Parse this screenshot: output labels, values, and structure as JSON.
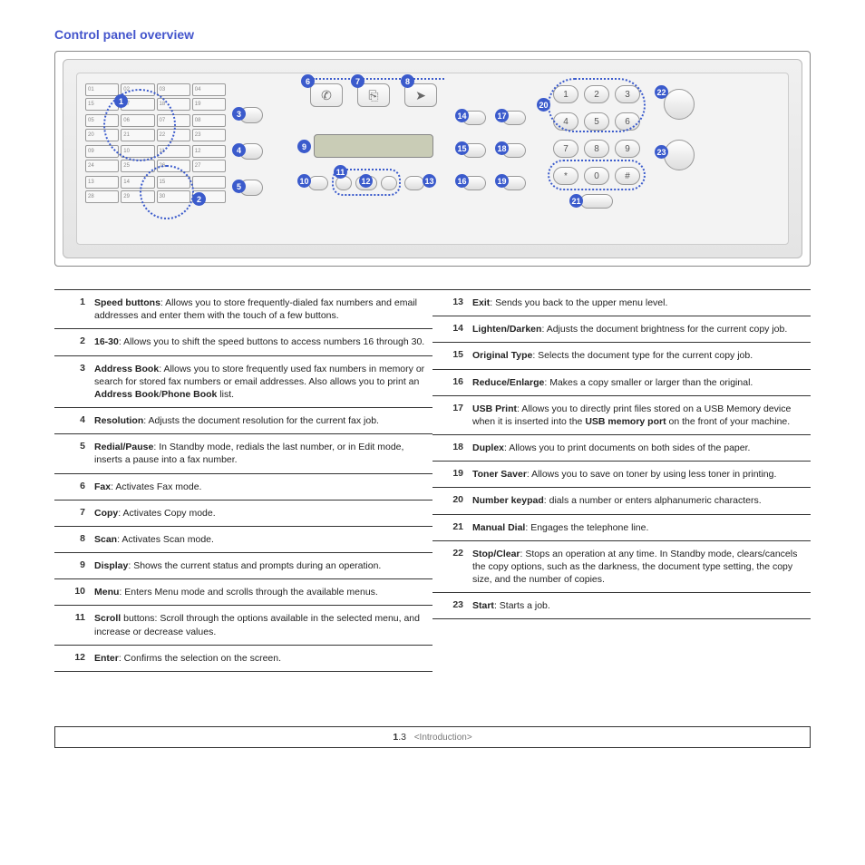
{
  "section_title": "Control panel overview",
  "speed_rows": [
    [
      "01",
      "02",
      "03",
      "04"
    ],
    [
      "15",
      "17",
      "18",
      "19"
    ],
    [
      "05",
      "06",
      "07",
      "08"
    ],
    [
      "20",
      "21",
      "22",
      "23"
    ],
    [
      "09",
      "10",
      "11",
      "12"
    ],
    [
      "24",
      "25",
      "26",
      "27"
    ],
    [
      "13",
      "14",
      "15",
      ""
    ],
    [
      "28",
      "29",
      "30",
      ""
    ]
  ],
  "keypad": [
    "1",
    "2",
    "3",
    "4",
    "5",
    "6",
    "7",
    "8",
    "9",
    "*",
    "0",
    "#"
  ],
  "callouts": {
    "c1": "1",
    "c2": "2",
    "c3": "3",
    "c4": "4",
    "c5": "5",
    "c6": "6",
    "c7": "7",
    "c8": "8",
    "c9": "9",
    "c10": "10",
    "c11": "11",
    "c12": "12",
    "c13": "13",
    "c14": "14",
    "c15": "15",
    "c16": "16",
    "c17": "17",
    "c18": "18",
    "c19": "19",
    "c20": "20",
    "c21": "21",
    "c22": "22",
    "c23": "23"
  },
  "definitions_left": [
    {
      "n": "1",
      "html": "<b>Speed buttons</b>: Allows you to store frequently-dialed fax numbers and email addresses and enter them with the touch of a few buttons."
    },
    {
      "n": "2",
      "html": "<b>16-30</b>: Allows you to shift the speed buttons to access numbers 16 through 30."
    },
    {
      "n": "3",
      "html": "<b>Address Book</b>: Allows you to store frequently used fax numbers in memory or search for stored fax numbers or email addresses. Also allows you to print an <b>Address Book</b>/<b>Phone Book</b> list."
    },
    {
      "n": "4",
      "html": "<b>Resolution</b>: Adjusts the document resolution for the current fax job."
    },
    {
      "n": "5",
      "html": "<b>Redial/Pause</b>: In Standby mode, redials the last number, or in Edit mode, inserts a pause into a fax number."
    },
    {
      "n": "6",
      "html": "<b>Fax</b>: Activates Fax mode."
    },
    {
      "n": "7",
      "html": "<b>Copy</b>: Activates Copy mode."
    },
    {
      "n": "8",
      "html": "<b>Scan</b>: Activates Scan mode."
    },
    {
      "n": "9",
      "html": "<b>Display</b>: Shows the current status and prompts during an operation."
    },
    {
      "n": "10",
      "html": "<b>Menu</b>: Enters Menu mode and scrolls through the available menus."
    },
    {
      "n": "11",
      "html": "<b>Scroll</b> buttons: Scroll through the options available in the selected menu, and increase or decrease values."
    },
    {
      "n": "12",
      "html": "<b>Enter</b>: Confirms the selection on the screen."
    }
  ],
  "definitions_right": [
    {
      "n": "13",
      "html": "<b>Exit</b>: Sends you back to the upper menu level."
    },
    {
      "n": "14",
      "html": "<b>Lighten/Darken</b>: Adjusts the document brightness for the current copy job."
    },
    {
      "n": "15",
      "html": "<b>Original Type</b>: Selects the document type for the current copy job."
    },
    {
      "n": "16",
      "html": "<b>Reduce/Enlarge</b>: Makes a copy smaller or larger than the original."
    },
    {
      "n": "17",
      "html": "<b>USB Print</b>: Allows you to directly print files stored on a USB Memory device when it is inserted into the <b>USB memory port</b> on the front of your machine."
    },
    {
      "n": "18",
      "html": "<b>Duplex</b>: Allows you to print documents on both sides of the paper."
    },
    {
      "n": "19",
      "html": "<b>Toner Saver</b>: Allows you to save on toner by using less toner in printing."
    },
    {
      "n": "20",
      "html": "<b>Number keypad</b>: dials a number or enters alphanumeric characters."
    },
    {
      "n": "21",
      "html": "<b>Manual Dial</b>: Engages the telephone line."
    },
    {
      "n": "22",
      "html": "<b>Stop/Clear</b>: Stops an operation at any time. In Standby mode, clears/cancels the copy options, such as the darkness, the document type setting, the copy size, and the number of copies."
    },
    {
      "n": "23",
      "html": "<b>Start</b>: Starts a job."
    }
  ],
  "footer": {
    "chapter": "1",
    "page": "3",
    "section": "<Introduction>"
  }
}
